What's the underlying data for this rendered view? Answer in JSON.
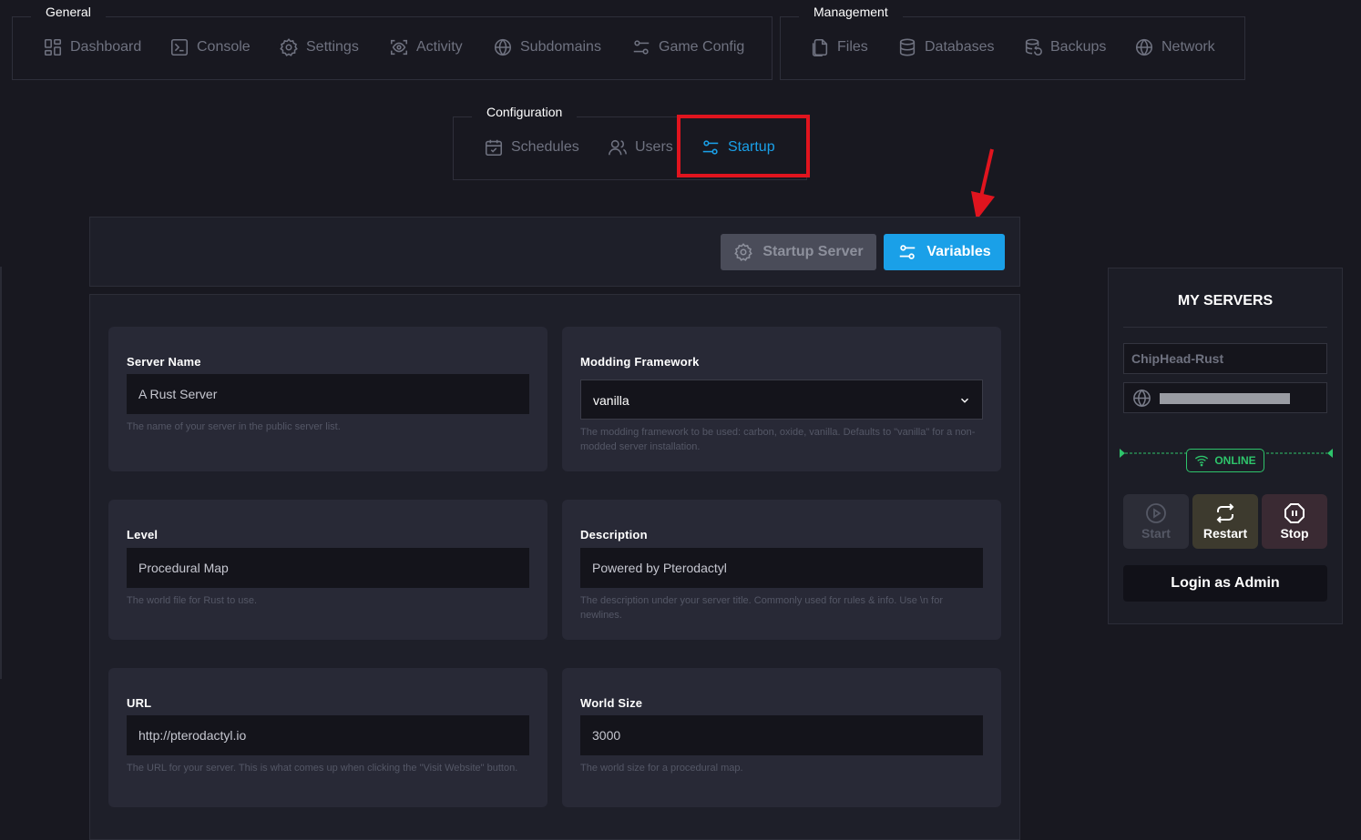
{
  "nav": {
    "general": {
      "title": "General",
      "items": [
        {
          "label": "Dashboard",
          "icon": "dashboard-icon"
        },
        {
          "label": "Console",
          "icon": "console-icon"
        },
        {
          "label": "Settings",
          "icon": "gear-icon"
        },
        {
          "label": "Activity",
          "icon": "activity-icon"
        },
        {
          "label": "Subdomains",
          "icon": "globe-icon"
        },
        {
          "label": "Game Config",
          "icon": "sliders-icon"
        }
      ]
    },
    "management": {
      "title": "Management",
      "items": [
        {
          "label": "Files",
          "icon": "files-icon"
        },
        {
          "label": "Databases",
          "icon": "database-icon"
        },
        {
          "label": "Backups",
          "icon": "backup-icon"
        },
        {
          "label": "Network",
          "icon": "globe-icon"
        }
      ]
    },
    "configuration": {
      "title": "Configuration",
      "items": [
        {
          "label": "Schedules",
          "icon": "calendar-icon"
        },
        {
          "label": "Users",
          "icon": "users-icon"
        },
        {
          "label": "Startup",
          "icon": "sliders-icon",
          "active": true
        }
      ]
    }
  },
  "toolbar": {
    "startup_server_label": "Startup Server",
    "variables_label": "Variables"
  },
  "variables": [
    {
      "label": "Server Name",
      "value": "A Rust Server",
      "help": "The name of your server in the public server list."
    },
    {
      "label": "Modding Framework",
      "value": "vanilla",
      "help": "The modding framework to be used: carbon, oxide, vanilla. Defaults to \"vanilla\" for a non-modded server installation."
    },
    {
      "label": "Level",
      "value": "Procedural Map",
      "help": "The world file for Rust to use."
    },
    {
      "label": "Description",
      "value": "Powered by Pterodactyl",
      "help": "The description under your server title. Commonly used for rules & info. Use \\n for newlines."
    },
    {
      "label": "URL",
      "value": "http://pterodactyl.io",
      "help": "The URL for your server. This is what comes up when clicking the \"Visit Website\" button."
    },
    {
      "label": "World Size",
      "value": "3000",
      "help": "The world size for a procedural map."
    }
  ],
  "my_servers": {
    "title": "MY SERVERS",
    "server_name": "ChipHead-Rust",
    "status": "ONLINE",
    "buttons": {
      "start": "Start",
      "restart": "Restart",
      "stop": "Stop"
    },
    "login_label": "Login as Admin"
  },
  "colors": {
    "accent": "#1aa0e8",
    "highlight": "#e0141e",
    "online": "#2ec46b"
  }
}
